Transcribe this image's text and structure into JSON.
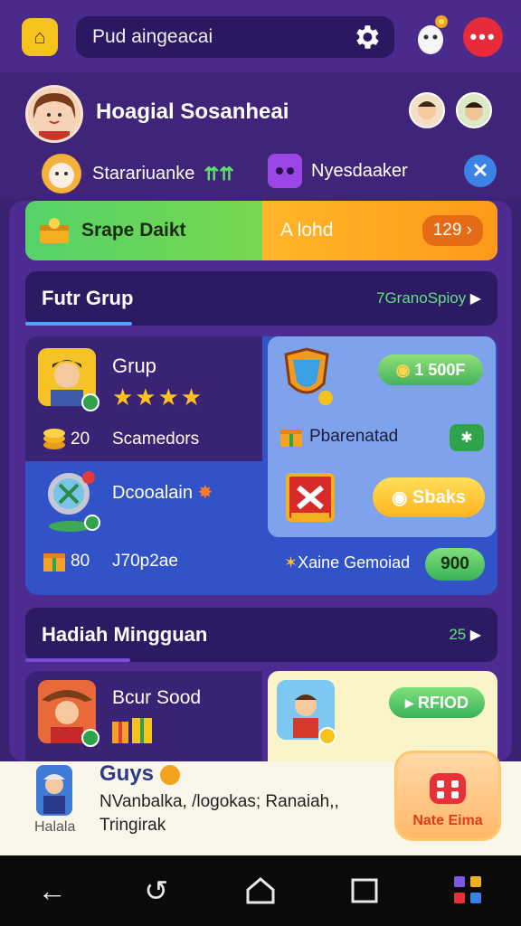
{
  "topbar": {
    "search_text": "Pud aingeacai",
    "icons": [
      "app-logo-icon",
      "gear-icon",
      "mascot-icon",
      "more-icon"
    ]
  },
  "profile": {
    "name": "Hoagial Sosanheai",
    "badge1_label": "Starariuanke",
    "badge2_label": "Nyesdaaker"
  },
  "promo": {
    "left_label": "Srape Daikt",
    "right_label": "A lohd",
    "pill_value": "129"
  },
  "section1": {
    "title": "Futr Grup",
    "link": "7GranoSpioy"
  },
  "card_group": {
    "title": "Grup",
    "stars": "★★★★",
    "coin_count": "20",
    "coin_label": "Scamedors"
  },
  "card_download": {
    "title": "Dcooalain",
    "count": "80",
    "label": "J70p2ae"
  },
  "card_right": {
    "price_label": "1 500F",
    "label": "Pbarenatad",
    "button_label": "Sbaks",
    "bottom_label": "Xaine Gemoiad",
    "bottom_value": "900"
  },
  "section2": {
    "title": "Hadiah Mingguan",
    "link_value": "25"
  },
  "card_bear": {
    "title": "Bcur Sood"
  },
  "card_yellow": {
    "button_label": "RFIOD"
  },
  "ad": {
    "app_label": "Halala",
    "title": "Guys",
    "line1": "NVanbalka, /logokas; Ranaiah,,",
    "line2": "Tringirak",
    "button_label": "Nate Eima"
  },
  "colors": {
    "background": "#3a2172",
    "accent_green": "#55d26a",
    "accent_orange": "#ff9a1a",
    "accent_red": "#e72b3a",
    "accent_blue": "#3253c8"
  }
}
